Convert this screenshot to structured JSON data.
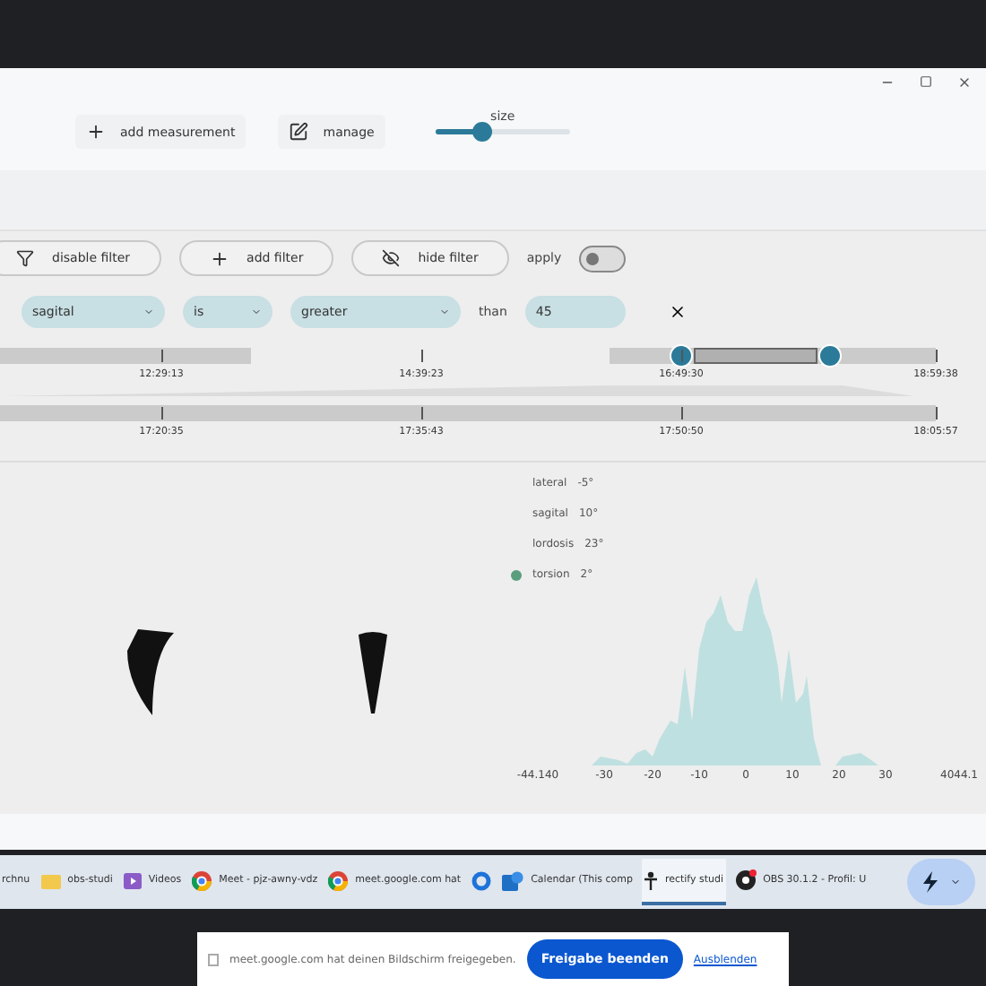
{
  "toolbar": {
    "buttons": [
      {
        "kind": "plus",
        "label": "add measurement"
      },
      {
        "kind": "edit",
        "label": "manage"
      }
    ],
    "size": {
      "label": "size",
      "level": 0.35
    }
  },
  "filter_bar": {
    "buttons": [
      {
        "kind": "filter",
        "label": "disable filter"
      },
      {
        "kind": "plus",
        "label": "add filter"
      },
      {
        "kind": "hide",
        "label": "hide filter"
      }
    ],
    "apply": {
      "label": "apply",
      "on": false
    }
  },
  "filter_row": {
    "selects": [
      "sagital",
      "is",
      "greater"
    ],
    "than": "than",
    "value": "45"
  },
  "timeline_overview": {
    "ticks": [
      "12:29:13",
      "14:39:23",
      "16:49:30",
      "18:59:38"
    ]
  },
  "timeline_detail": {
    "ticks": [
      "17:20:35",
      "17:35:43",
      "17:50:50",
      "18:05:57"
    ]
  },
  "legend": [
    {
      "name": "lateral",
      "value": "-5°",
      "selected": false
    },
    {
      "name": "sagital",
      "value": "10°",
      "selected": false
    },
    {
      "name": "lordosis",
      "value": "23°",
      "selected": false
    },
    {
      "name": "torsion",
      "value": "2°",
      "selected": true
    }
  ],
  "histogram": {
    "x_labels": [
      "-44.140",
      "-30",
      "-20",
      "-10",
      "0",
      "10",
      "20",
      "30",
      "4044.1"
    ]
  },
  "taskbar": [
    {
      "kind": "none",
      "label": "rchnu",
      "selected": false
    },
    {
      "kind": "folder",
      "label": "obs-studi",
      "selected": false
    },
    {
      "kind": "video",
      "label": "Videos",
      "selected": false
    },
    {
      "kind": "browser",
      "label": "Meet - pjz-awny-vdz",
      "selected": false
    },
    {
      "kind": "browser",
      "label": "meet.google.com hat",
      "selected": false
    },
    {
      "kind": "ring",
      "selected": false
    },
    {
      "kind": "calendar",
      "label": "Calendar (This comp",
      "selected": false
    },
    {
      "kind": "person",
      "label": "rectify studi",
      "selected": true
    },
    {
      "kind": "record",
      "label": "OBS 30.1.2 - Profil: U",
      "selected": false
    }
  ],
  "share_bar": {
    "message": "meet.google.com hat deinen Bildschirm freigegeben.",
    "button": "Freigabe beenden",
    "link": "Ausblenden"
  }
}
